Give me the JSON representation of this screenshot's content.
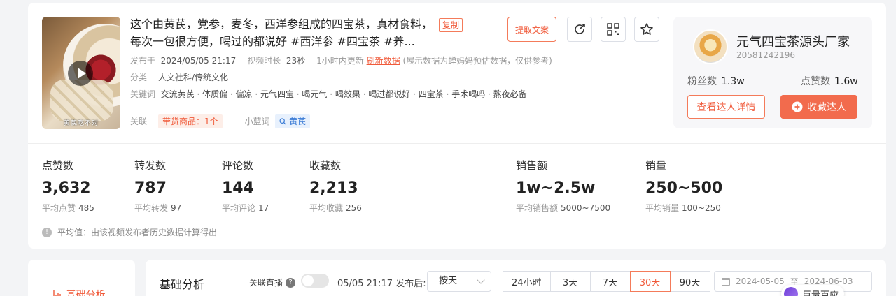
{
  "video": {
    "thumbnail_caption": "黄芪吃不对",
    "title": "这个由黄芪，党参，麦冬，西洋参组成的四宝茶，真材食料，每次一包很方便，喝过的都说好 #西洋参 #四宝茶 #养...",
    "copy_label": "复制",
    "extract_label": "提取文案",
    "publish_label": "发布于",
    "publish_time": "2024/05/05 21:17",
    "duration_label": "视频时长",
    "duration": "23秒",
    "update_note": "1小时内更新",
    "refresh_label": "刷新数据",
    "estimate_note": "(展示数据为蝉妈妈预估数据，仅供参考)",
    "category_label": "分类",
    "category": "人文社科/传统文化",
    "keywords_label": "关键词",
    "keywords": "交流黄芪 · 体质偏 · 偏凉 · 元气四宝 · 喝元气 · 喝效果 · 喝过都说好 · 四宝茶 · 手术喝吗 · 熬夜必备",
    "related_label": "关联",
    "goods_tag": "带货商品：1个",
    "bluelink_label": "小蓝词",
    "bluelink_tag": "黄芪"
  },
  "author": {
    "name": "元气四宝茶源头厂家",
    "id": "20581242196",
    "fans_label": "粉丝数",
    "fans": "1.3w",
    "likes_label": "点赞数",
    "likes": "1.6w",
    "detail_btn": "查看达人详情",
    "collect_btn": "收藏达人"
  },
  "stats": [
    {
      "label": "点赞数",
      "value": "3,632",
      "avg_label": "平均点赞",
      "avg": "485"
    },
    {
      "label": "转发数",
      "value": "787",
      "avg_label": "平均转发",
      "avg": "97"
    },
    {
      "label": "评论数",
      "value": "144",
      "avg_label": "平均评论",
      "avg": "17"
    },
    {
      "label": "收藏数",
      "value": "2,213",
      "avg_label": "平均收藏",
      "avg": "256"
    },
    {
      "label": "销售额",
      "value": "1w~2.5w",
      "avg_label": "平均销售额",
      "avg": "5000~7500"
    },
    {
      "label": "销量",
      "value": "250~500",
      "avg_label": "平均销量",
      "avg": "100~250"
    }
  ],
  "avg_note": "平均值：由该视频发布者历史数据计算得出",
  "analysis": {
    "side_item": "基础分析",
    "title": "基础分析",
    "live_label": "关联直播",
    "after_label": "05/05 21:17 发布后:",
    "select_value": "按天",
    "ranges": [
      "24小时",
      "3天",
      "7天",
      "30天",
      "90天"
    ],
    "active_range": "30天",
    "date_start": "2024-05-05",
    "date_sep": "至",
    "date_end": "2024-06-03",
    "float_chip": "巨量百应"
  },
  "colors": {
    "accent": "#f05a3a",
    "accent_bg": "#fdeee8",
    "blue": "#3a7bd5"
  }
}
